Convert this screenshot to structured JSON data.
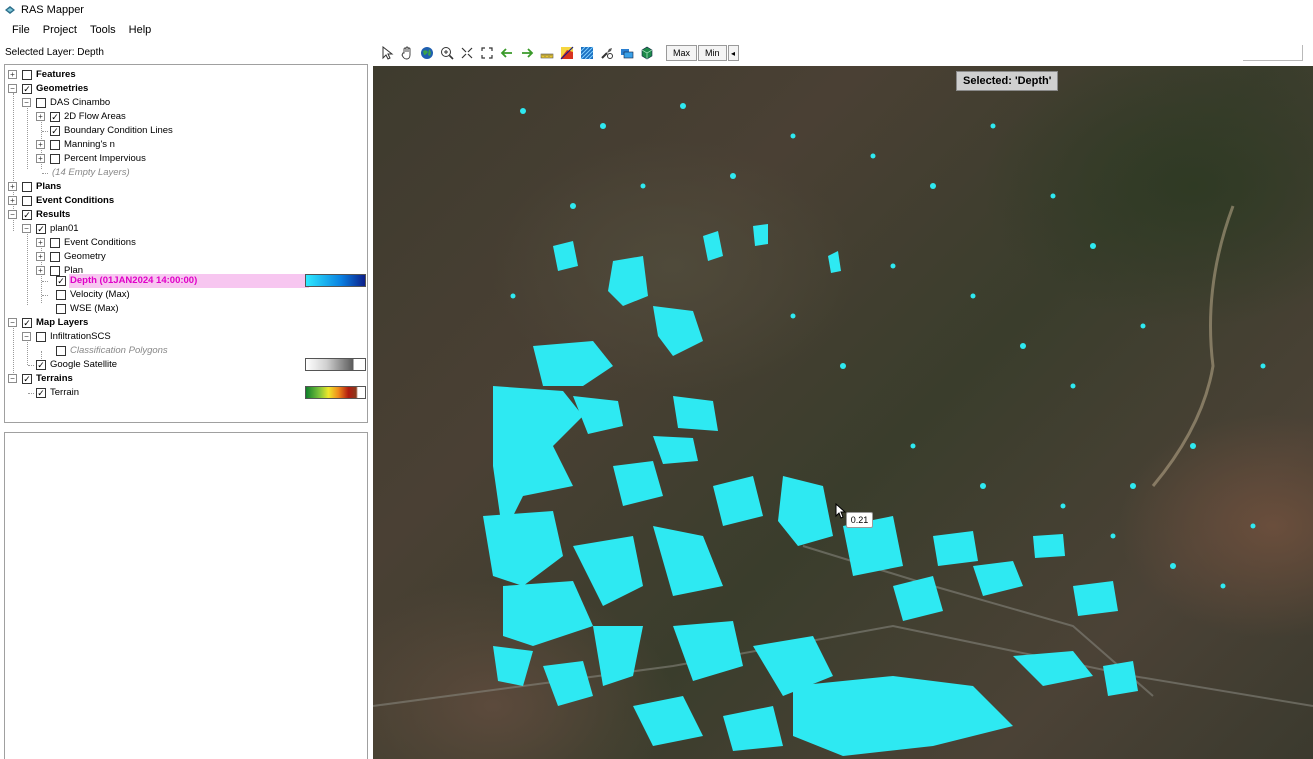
{
  "window": {
    "title": "RAS Mapper",
    "icon": "ras-mapper-icon"
  },
  "menu": [
    "File",
    "Project",
    "Tools",
    "Help"
  ],
  "selected_layer_label": "Selected Layer: Depth",
  "toolbar": {
    "icons": [
      "select-arrow-icon",
      "pan-hand-icon",
      "globe-icon",
      "zoom-in-icon",
      "zoom-extents-icon",
      "full-extent-icon",
      "back-arrow-icon",
      "forward-arrow-icon",
      "measure-icon",
      "profile-icon",
      "raster-icon",
      "tool-icon",
      "layers-icon",
      "3d-box-icon"
    ],
    "max_label": "Max",
    "min_label": "Min",
    "step_label": "◂"
  },
  "tree": {
    "features": "Features",
    "geometries": "Geometries",
    "das": "DAS Cinambo",
    "flow_areas": "2D Flow Areas",
    "bc_lines": "Boundary Condition Lines",
    "mannings": "Manning's n",
    "impervious": "Percent Impervious",
    "empty_layers": "(14 Empty Layers)",
    "plans": "Plans",
    "event_conditions": "Event Conditions",
    "results": "Results",
    "plan01": "plan01",
    "res_event": "Event Conditions",
    "res_geometry": "Geometry",
    "res_plan": "Plan",
    "depth": "Depth (01JAN2024 14:00:00)",
    "velocity": "Velocity (Max)",
    "wse": "WSE (Max)",
    "map_layers": "Map Layers",
    "infiltration": "InfiltrationSCS",
    "classification": "Classification Polygons",
    "google": "Google Satellite",
    "terrains": "Terrains",
    "terrain": "Terrain"
  },
  "map": {
    "selected_badge": "Selected: 'Depth'",
    "tooltip_value": "0.21",
    "flood_color": "#2ee9f2"
  }
}
